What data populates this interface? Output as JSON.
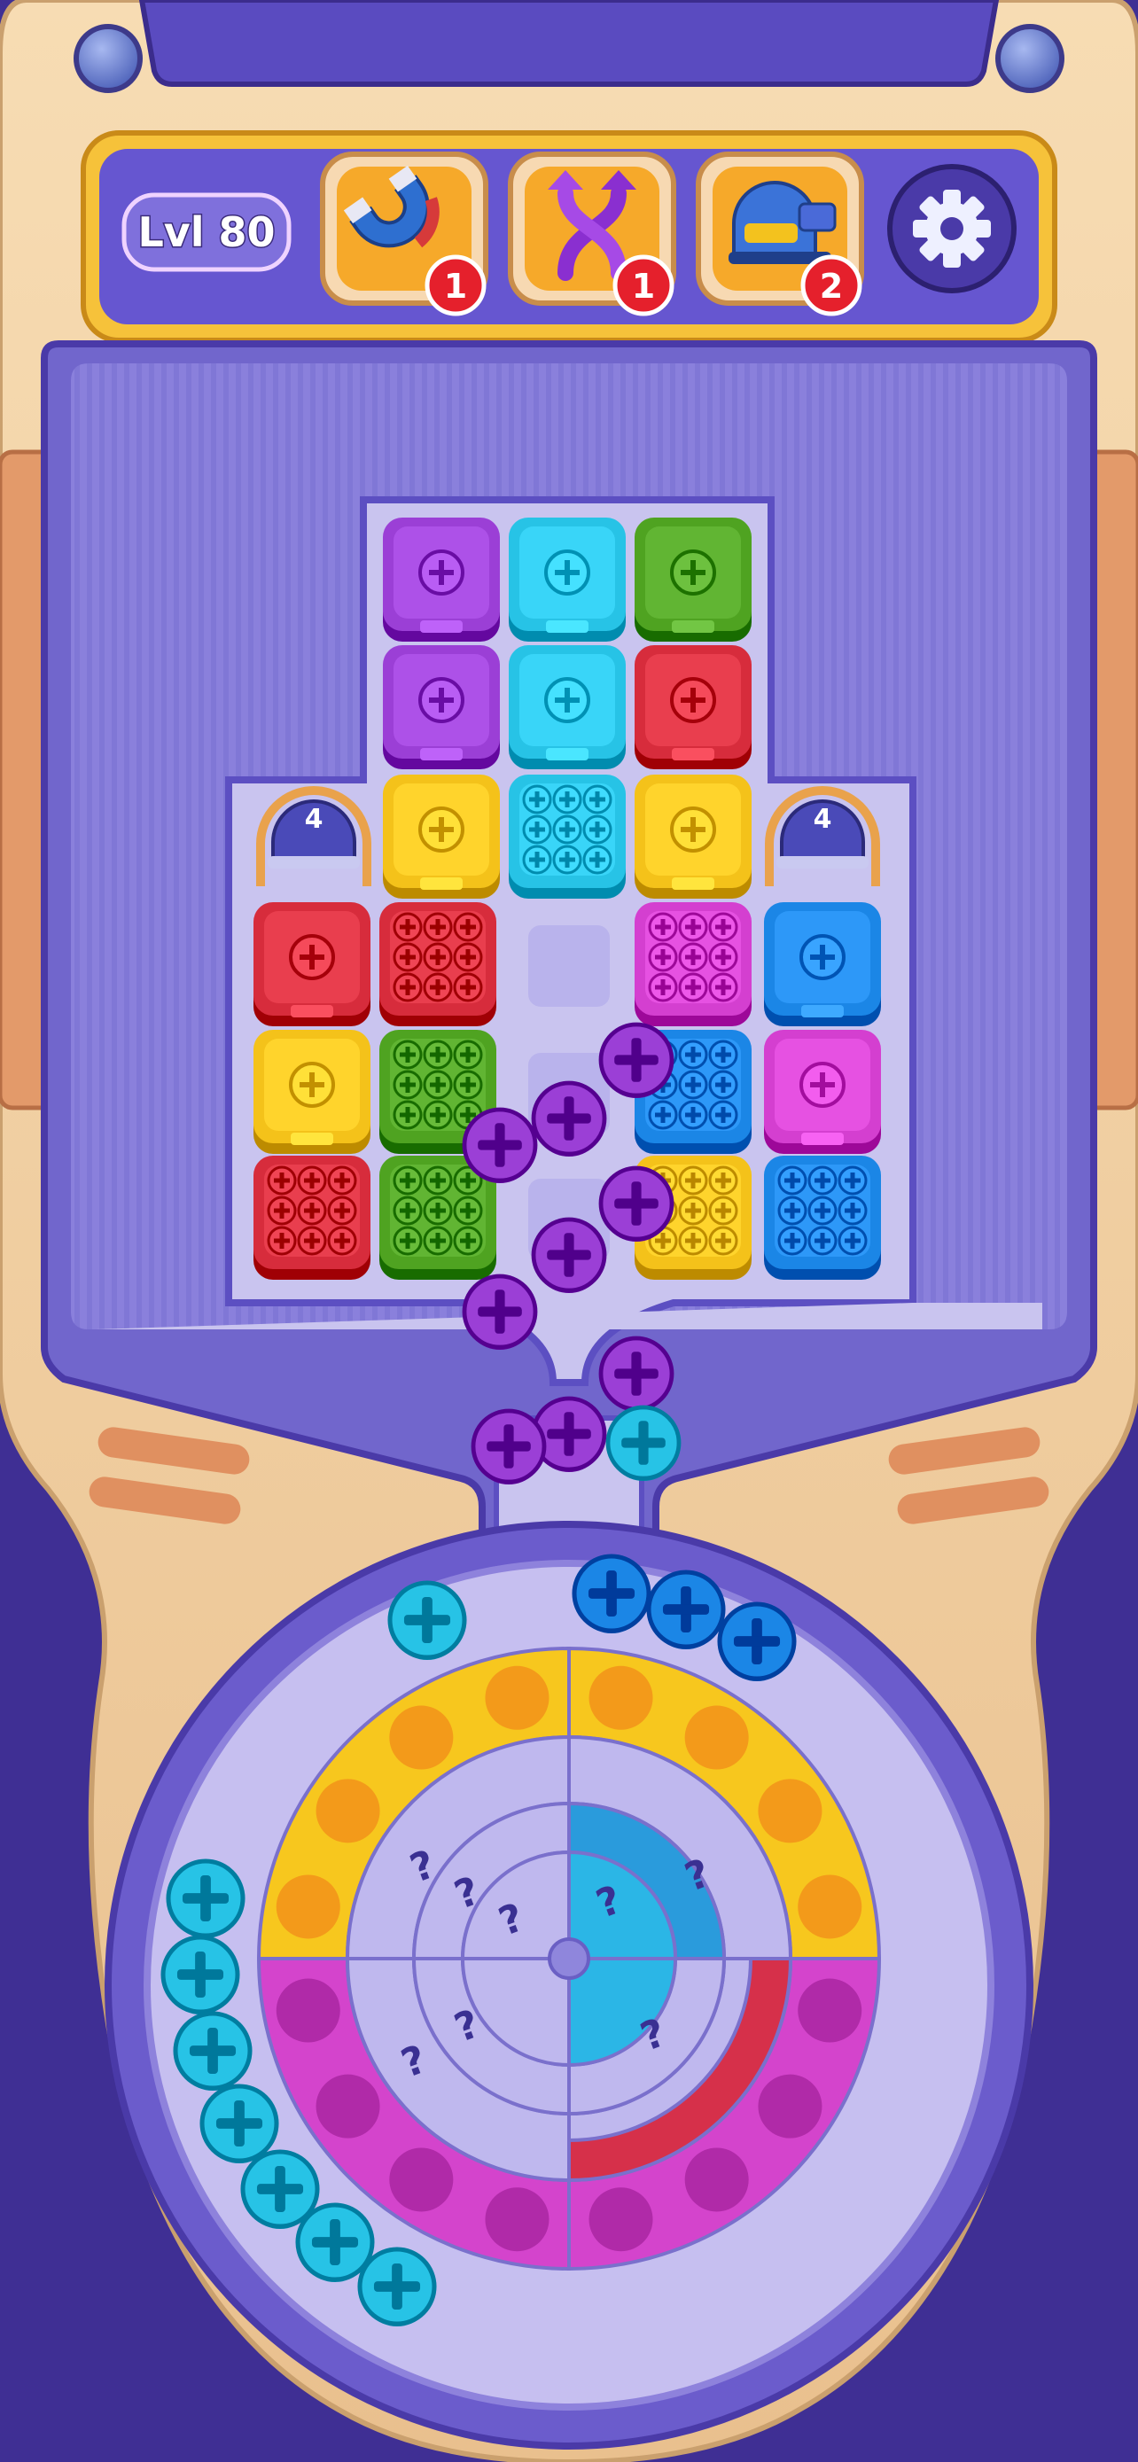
{
  "hud": {
    "level_label": "Lvl 80",
    "boosters": [
      {
        "name": "magnet",
        "icon": "magnet-icon",
        "count": "1"
      },
      {
        "name": "swap",
        "icon": "swap-arrows-icon",
        "count": "1"
      },
      {
        "name": "helmet",
        "icon": "helmet-cannon-icon",
        "count": "2"
      }
    ],
    "settings_icon": "gear-icon"
  },
  "colors": {
    "purple": "#9b3fd6",
    "cyan": "#27c3e6",
    "green": "#4fa321",
    "red": "#d72c3c",
    "yellow": "#f4c21a",
    "magenta": "#d43fd0",
    "blue": "#1b86e6",
    "frame": "#f3d3a4",
    "board": "#8b80dc"
  },
  "board": {
    "lock_counts": [
      "4",
      "4"
    ]
  },
  "wheel": {
    "outer_ring": [
      {
        "color": "yellow",
        "slots": 4
      },
      {
        "color": "yellow",
        "slots": 4
      },
      {
        "color": "magenta",
        "slots": 4
      },
      {
        "color": "magenta",
        "slots": 4
      }
    ],
    "hidden_mark": "?"
  }
}
